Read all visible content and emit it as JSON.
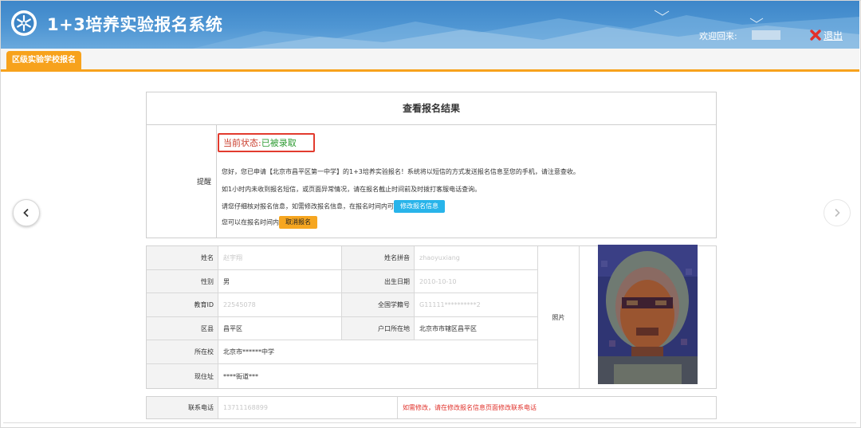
{
  "header": {
    "app_title": "1+3培养实验报名系统",
    "welcome": "欢迎回来:",
    "logout": "退出",
    "logo_icon": "snowflake-badge-icon",
    "logout_icon": "red-x-icon"
  },
  "tabs": [
    {
      "label": "区级实验学校报名",
      "active": true
    }
  ],
  "carousel": {
    "prev_icon": "chevron-left-icon",
    "next_icon": "chevron-right-icon"
  },
  "result": {
    "title": "查看报名结果",
    "remind_label": "提醒",
    "status_label": "当前状态:",
    "status_value": "已被录取",
    "line1": "您好，您已申请【北京市昌平区第一中学】的1+3培养实验报名！系统将以短信的方式发送报名信息至您的手机，请注意查收。",
    "line2": "如1小时内未收到报名短信，或页面异常情况，请在报名截止时间前及时拨打客服电话查询。",
    "line3": "请您仔细核对报名信息，如需修改报名信息，在报名时间内可",
    "edit_button": "修改报名信息",
    "line4": "您可以在报名时间内",
    "cancel_button": "取消报名"
  },
  "info": {
    "name_label": "姓名",
    "name_value": "赵宇翔",
    "pinyin_label": "姓名拼音",
    "pinyin_value": "zhaoyuxiang",
    "gender_label": "性别",
    "gender_value": "男",
    "birth_label": "出生日期",
    "birth_value": "2010-10-10",
    "edu_id_label": "教育ID",
    "edu_id_value": "22545078",
    "student_no_label": "全国学籍号",
    "student_no_value": "G11111**********2",
    "district_label": "区县",
    "district_value": "昌平区",
    "hukou_label": "户口所在地",
    "hukou_value": "北京市市辖区昌平区",
    "school_label": "所在校",
    "school_value": "北京市******中学",
    "address_label": "现住址",
    "address_value": "****街道***",
    "photo_label": "照片"
  },
  "contact": {
    "phone_label": "联系电话",
    "phone_value": "13711168899",
    "note": "如需修改，请在修改报名信息页面修改联系电话"
  },
  "colors": {
    "header_blue": "#4f96d3",
    "tab_orange": "#f7a21c",
    "status_red": "#c93b2a",
    "status_green": "#2d9b32",
    "button_blue": "#28b4ea",
    "warn_red": "#e0322b"
  }
}
